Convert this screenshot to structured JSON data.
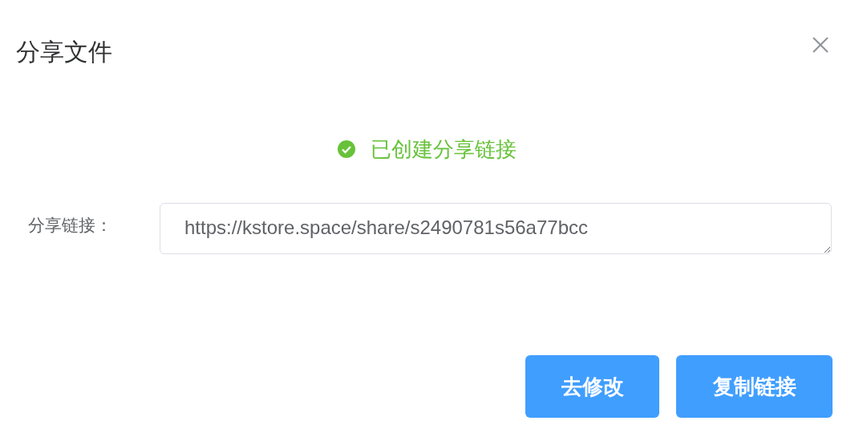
{
  "dialog": {
    "title": "分享文件"
  },
  "status": {
    "kind": "success",
    "message": "已创建分享链接"
  },
  "field": {
    "label": "分享链接：",
    "value": "https://kstore.space/share/s2490781s56a77bcc"
  },
  "buttons": [
    {
      "label": "去修改"
    },
    {
      "label": "复制链接"
    }
  ]
}
